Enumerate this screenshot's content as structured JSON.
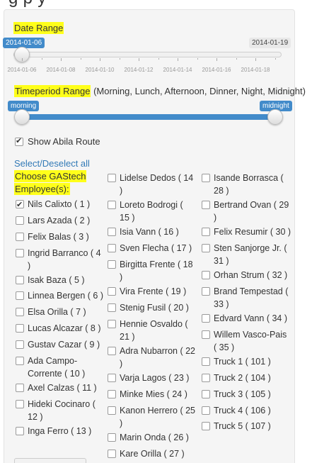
{
  "date_range": {
    "label": "Date Range",
    "min_value": "2014-01-06",
    "max_value": "2014-01-19",
    "ticks": [
      "2014-01-06",
      "2014-01-08",
      "2014-01-10",
      "2014-01-12",
      "2014-01-14",
      "2014-01-16",
      "2014-01-18"
    ]
  },
  "timeperiod": {
    "label": "Timeperiod Range",
    "label_extra": " (Morning, Lunch, Afternoon, Dinner, Night, Midnight)",
    "min_value": "morning",
    "max_value": "midnight"
  },
  "abila_route": {
    "label": "Show Abila Route",
    "checked": true
  },
  "select_all": {
    "label": "Select/Deselect all"
  },
  "employees": {
    "heading_line1": "Choose GAStech",
    "heading_line2": "Employee(s):",
    "col1": [
      {
        "l1": "Nils Calixto ( 1 )",
        "l2": "",
        "checked": true
      },
      {
        "l1": "Lars Azada ( 2 )",
        "l2": "",
        "checked": false
      },
      {
        "l1": "Felix Balas ( 3 )",
        "l2": "",
        "checked": false
      },
      {
        "l1": "Ingrid Barranco ( 4",
        "l2": ")",
        "checked": false
      },
      {
        "l1": "Isak Baza ( 5 )",
        "l2": "",
        "checked": false
      },
      {
        "l1": "Linnea Bergen ( 6 )",
        "l2": "",
        "checked": false
      },
      {
        "l1": "Elsa Orilla ( 7 )",
        "l2": "",
        "checked": false
      },
      {
        "l1": "Lucas Alcazar ( 8 )",
        "l2": "",
        "checked": false
      },
      {
        "l1": "Gustav Cazar ( 9 )",
        "l2": "",
        "checked": false
      },
      {
        "l1": "Ada Campo-",
        "l2": "Corrente ( 10 )",
        "checked": false
      },
      {
        "l1": "Axel Calzas ( 11 )",
        "l2": "",
        "checked": false
      },
      {
        "l1": "Hideki Cocinaro (",
        "l2": "12 )",
        "checked": false
      },
      {
        "l1": "Inga Ferro ( 13 )",
        "l2": "",
        "checked": false
      }
    ],
    "col2": [
      {
        "l1": "Lidelse Dedos ( 14",
        "l2": ")",
        "checked": false
      },
      {
        "l1": "Loreto Bodrogi (",
        "l2": "15 )",
        "checked": false
      },
      {
        "l1": "Isia Vann ( 16 )",
        "l2": "",
        "checked": false
      },
      {
        "l1": "Sven Flecha ( 17 )",
        "l2": "",
        "checked": false
      },
      {
        "l1": "Birgitta Frente ( 18",
        "l2": ")",
        "checked": false
      },
      {
        "l1": "Vira Frente ( 19 )",
        "l2": "",
        "checked": false
      },
      {
        "l1": "Stenig Fusil ( 20 )",
        "l2": "",
        "checked": false
      },
      {
        "l1": "Hennie Osvaldo (",
        "l2": "21 )",
        "checked": false
      },
      {
        "l1": "Adra Nubarron ( 22",
        "l2": ")",
        "checked": false
      },
      {
        "l1": "Varja Lagos ( 23 )",
        "l2": "",
        "checked": false
      },
      {
        "l1": "Minke Mies ( 24 )",
        "l2": "",
        "checked": false
      },
      {
        "l1": "Kanon Herrero ( 25",
        "l2": ")",
        "checked": false
      },
      {
        "l1": "Marin Onda ( 26 )",
        "l2": "",
        "checked": false
      },
      {
        "l1": "Kare Orilla ( 27 )",
        "l2": "",
        "checked": false
      }
    ],
    "col3": [
      {
        "l1": "Isande Borrasca (",
        "l2": "28 )",
        "checked": false
      },
      {
        "l1": "Bertrand Ovan ( 29",
        "l2": ")",
        "checked": false
      },
      {
        "l1": "Felix Resumir ( 30 )",
        "l2": "",
        "checked": false
      },
      {
        "l1": "Sten Sanjorge Jr. (",
        "l2": "31 )",
        "checked": false
      },
      {
        "l1": "Orhan Strum ( 32 )",
        "l2": "",
        "checked": false
      },
      {
        "l1": "Brand Tempestad (",
        "l2": "33 )",
        "checked": false
      },
      {
        "l1": "Edvard Vann ( 34 )",
        "l2": "",
        "checked": false
      },
      {
        "l1": "Willem Vasco-Pais",
        "l2": "( 35 )",
        "checked": false
      },
      {
        "l1": "Truck 1 ( 101 )",
        "l2": "",
        "checked": false
      },
      {
        "l1": "Truck 2 ( 104 )",
        "l2": "",
        "checked": false
      },
      {
        "l1": "Truck 3 ( 105 )",
        "l2": "",
        "checked": false
      },
      {
        "l1": "Truck 4 ( 106 )",
        "l2": "",
        "checked": false
      },
      {
        "l1": "Truck 5 ( 107 )",
        "l2": "",
        "checked": false
      }
    ]
  },
  "colors": {
    "accent": "#428bca",
    "highlight": "#ffff1a",
    "link": "#337ab7"
  }
}
